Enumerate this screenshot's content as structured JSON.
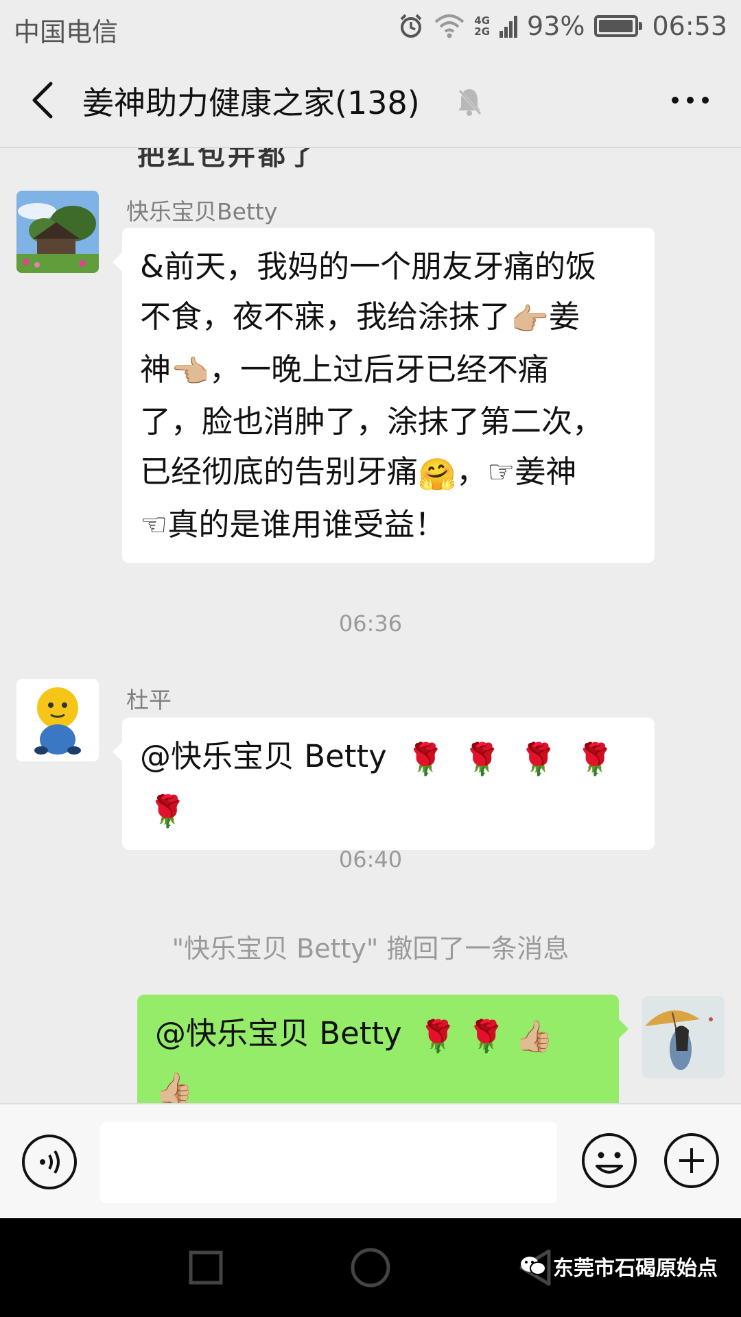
{
  "status_bar": {
    "carrier": "中国电信",
    "network_top": "4G",
    "network_bottom": "2G",
    "battery": "93%",
    "battery_level": 0.93,
    "time": "06:53"
  },
  "header": {
    "title": "姜神助力健康之家(138)",
    "icons": [
      "back-arrow-icon",
      "mute-bell-icon",
      "more-dots-icon"
    ]
  },
  "chat": {
    "cut_off_text": "把红包并都了",
    "messages": [
      {
        "sender": "快乐宝贝Betty",
        "lines": [
          "&前天，我妈的一个朋友牙痛的饭",
          [
            "不食，夜不寐，我给涂抹了",
            "👉🏼",
            "姜"
          ],
          [
            "神",
            "👈🏼",
            "，一晚上过后牙已经不痛"
          ],
          "了，脸也消肿了，涂抹了第二次，",
          [
            "已经彻底的告别牙痛",
            "🤗",
            "，",
            "☞",
            "姜神"
          ],
          [
            "☜",
            "真的是谁用谁受益！"
          ]
        ]
      },
      {
        "timestamp": "06:36"
      },
      {
        "sender": "杜平",
        "text": "@快乐宝贝 Betty",
        "emojis": [
          "🌹",
          "🌹",
          "🌹",
          "🌹",
          "🌹"
        ]
      },
      {
        "timestamp": "06:40"
      },
      {
        "system": "\"快乐宝贝 Betty\" 撤回了一条消息"
      },
      {
        "sender": "self",
        "text": "@快乐宝贝 Betty",
        "emojis": [
          "🌹",
          "🌹",
          "👍🏼",
          "👍🏼"
        ]
      }
    ]
  },
  "input_bar": {
    "placeholder": "",
    "icons": [
      "voice-icon",
      "emoji-icon",
      "plus-icon"
    ]
  },
  "nav_bar": {
    "icons": [
      "recent-apps-icon",
      "home-icon",
      "back-icon"
    ],
    "watermark": "东莞市石碣原始点"
  },
  "colors": {
    "background": "#ededed",
    "self_bubble": "#95ec69",
    "other_bubble": "#ffffff",
    "meta_text": "#9a9a9a"
  }
}
